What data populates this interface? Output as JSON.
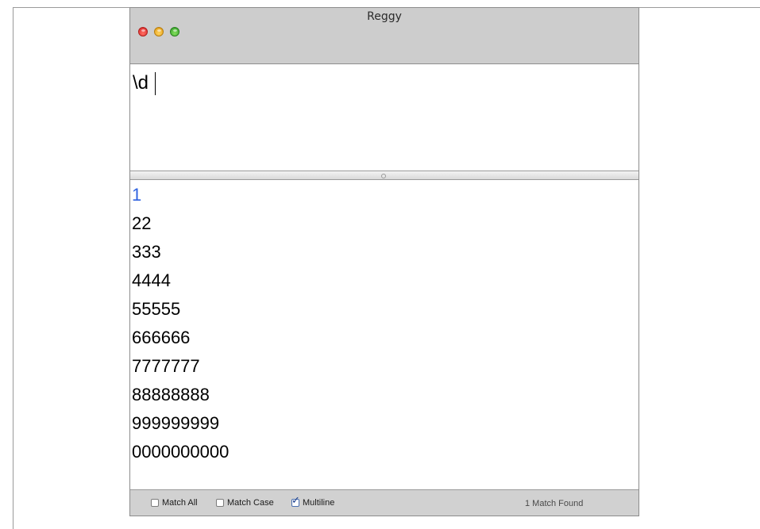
{
  "window": {
    "title": "Reggy",
    "pattern": "\\d"
  },
  "text": {
    "lines": [
      "1",
      "22",
      "333",
      "4444",
      "55555",
      "666666",
      "7777777",
      "88888888",
      "999999999",
      "0000000000"
    ],
    "match_color": "#2f63e0"
  },
  "options": {
    "match_all": {
      "label": "Match All",
      "checked": false
    },
    "match_case": {
      "label": "Match Case",
      "checked": false
    },
    "multiline": {
      "label": "Multiline",
      "checked": true
    }
  },
  "status": {
    "text": "1 Match Found"
  },
  "icons": {
    "check": "✓"
  }
}
